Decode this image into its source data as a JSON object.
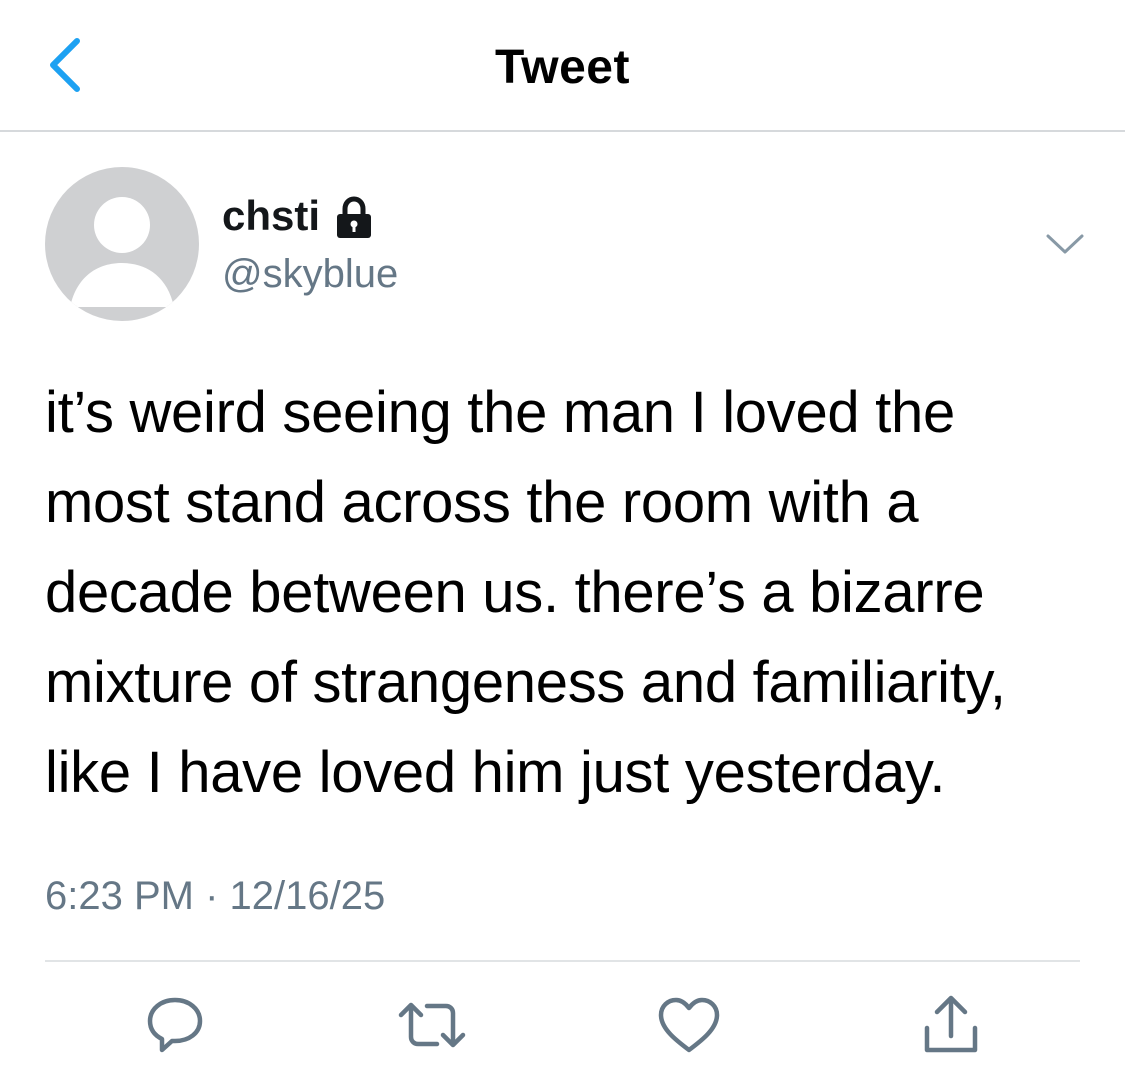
{
  "nav": {
    "title": "Tweet",
    "back_icon": "chevron-left-icon"
  },
  "tweet": {
    "author": {
      "name": "chsti",
      "handle": "@skyblue",
      "protected": true
    },
    "text": "it’s weird seeing the man I loved the most stand across the room with a decade between us. there’s a bizarre mixture of strangeness and familiarity, like I have loved him just yesterday.",
    "timestamp": "6:23 PM · 12/16/25"
  },
  "actions": [
    {
      "name": "reply",
      "icon": "reply-icon"
    },
    {
      "name": "retweet",
      "icon": "retweet-icon"
    },
    {
      "name": "like",
      "icon": "heart-icon"
    },
    {
      "name": "share",
      "icon": "share-icon"
    }
  ],
  "colors": {
    "accent": "#1da1f2",
    "secondary_text": "#657786",
    "icon_gray": "#657786",
    "avatar_bg": "#cfd0d2",
    "divider": "#e1e4e6"
  }
}
